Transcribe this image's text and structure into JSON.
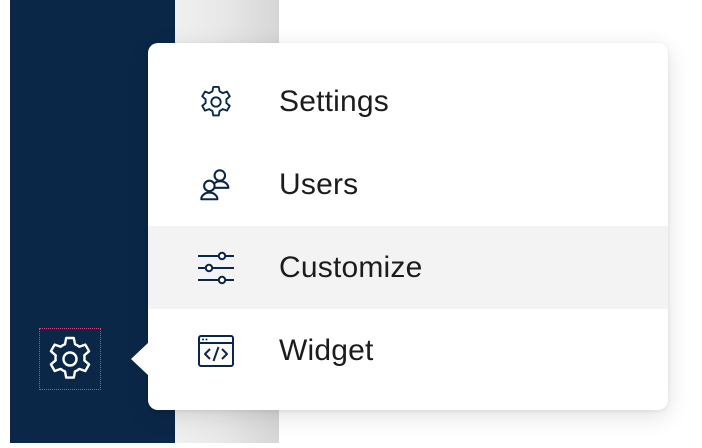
{
  "sidebar": {
    "settings_icon": "gear-icon",
    "background_color": "#0b2748"
  },
  "menu": {
    "items": [
      {
        "label": "Settings",
        "icon": "gear-icon"
      },
      {
        "label": "Users",
        "icon": "users-icon"
      },
      {
        "label": "Customize",
        "icon": "sliders-icon"
      },
      {
        "label": "Widget",
        "icon": "widget-code-icon"
      }
    ],
    "highlighted_item": "Customize",
    "icon_color": "#0b2748",
    "highlight_color": "#f3f3f3"
  }
}
